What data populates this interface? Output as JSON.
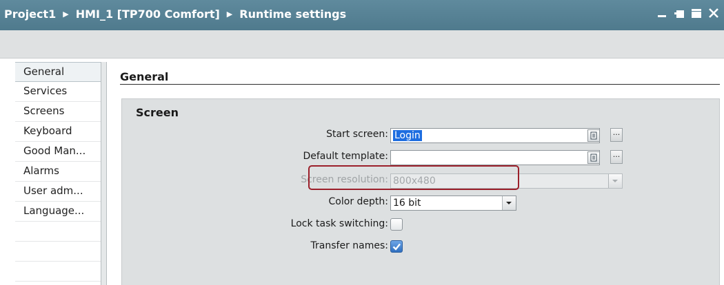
{
  "breadcrumb": {
    "project": "Project1",
    "device": "HMI_1 [TP700 Comfort]",
    "page": "Runtime settings"
  },
  "window_controls": [
    "minimize-icon",
    "float-icon",
    "maximize-icon",
    "close-icon"
  ],
  "nav": {
    "items": [
      {
        "label": "General",
        "selected": true
      },
      {
        "label": "Services"
      },
      {
        "label": "Screens"
      },
      {
        "label": "Keyboard"
      },
      {
        "label": "Good Man..."
      },
      {
        "label": "Alarms"
      },
      {
        "label": "User adm..."
      },
      {
        "label": "Language..."
      }
    ]
  },
  "main": {
    "section_title": "General",
    "group_title": "Screen",
    "fields": {
      "start_screen": {
        "label": "Start screen:",
        "value": "Login"
      },
      "default_template": {
        "label": "Default template:",
        "value": ""
      },
      "screen_resolution": {
        "label": "Screen resolution:",
        "value": "800x480",
        "disabled": true
      },
      "color_depth": {
        "label": "Color depth:",
        "value": "16 bit"
      },
      "lock_task_switching": {
        "label": "Lock task switching:",
        "checked": false
      },
      "transfer_names": {
        "label": "Transfer names:",
        "checked": true
      }
    }
  },
  "colors": {
    "titlebar": "#4f7a8d",
    "highlight": "#9b1f2a",
    "selection": "#1e6ee0"
  }
}
